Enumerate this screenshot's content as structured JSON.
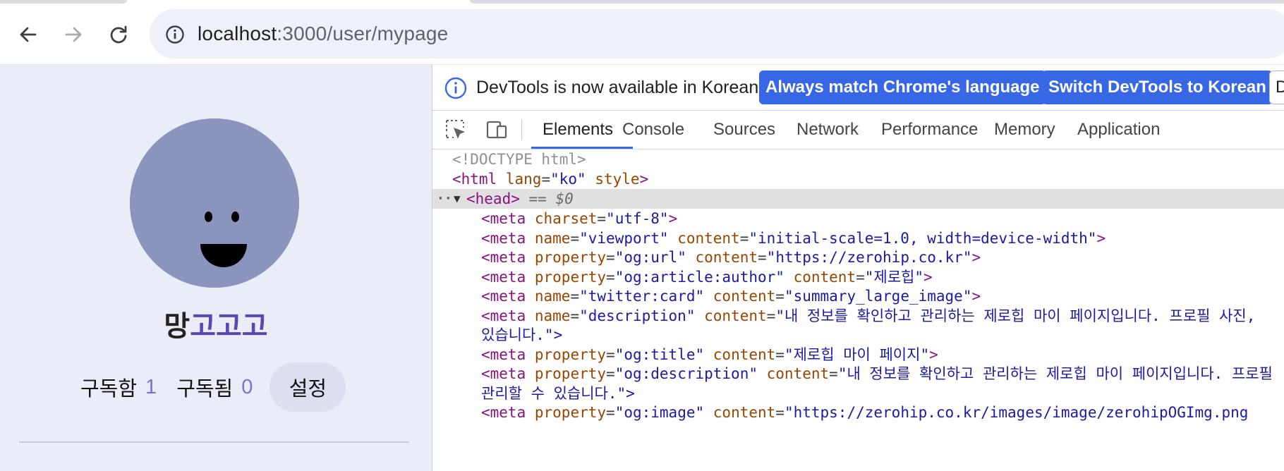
{
  "browser": {
    "url_host": "localhost",
    "url_path": ":3000/user/mypage",
    "nav": {
      "back_icon": "arrow-left",
      "forward_icon": "arrow-right",
      "reload_icon": "reload"
    }
  },
  "page": {
    "username_part1": "망",
    "username_part2": "고고고",
    "following_label": "구독함",
    "following_count": "1",
    "followers_label": "구독됨",
    "followers_count": "0",
    "settings_label": "설정"
  },
  "devtools": {
    "infobar": {
      "message": "DevTools is now available in Korean!",
      "button_match": "Always match Chrome's language",
      "button_switch": "Switch DevTools to Korean",
      "button_dismiss": "D"
    },
    "tabs": [
      "Elements",
      "Console",
      "Sources",
      "Network",
      "Performance",
      "Memory",
      "Application"
    ],
    "active_tab": "Elements",
    "code": {
      "doctype": "<!DOCTYPE html>",
      "html_open": "<html",
      "html_lang_attr": "lang",
      "html_lang_val": "\"ko\"",
      "html_style_attr": "style",
      "head_tag": "<head>",
      "head_ref": "== $0",
      "meta": [
        {
          "attr1": "charset",
          "val1": "\"utf-8\"",
          "attr2": "",
          "val2": ""
        },
        {
          "attr1": "name",
          "val1": "\"viewport\"",
          "attr2": "content",
          "val2": "\"initial-scale=1.0, width=device-width\""
        },
        {
          "attr1": "property",
          "val1": "\"og:url\"",
          "attr2": "content",
          "val2": "\"https://zerohip.co.kr\""
        },
        {
          "attr1": "property",
          "val1": "\"og:article:author\"",
          "attr2": "content",
          "val2": "\"제로힙\""
        },
        {
          "attr1": "name",
          "val1": "\"twitter:card\"",
          "attr2": "content",
          "val2": "\"summary_large_image\""
        },
        {
          "attr1": "name",
          "val1": "\"description\"",
          "attr2": "content",
          "val2": "\"내 정보를 확인하고 관리하는 제로힙 마이 페이지입니다. 프로필 사진,"
        },
        {
          "attr1": "property",
          "val1": "\"og:title\"",
          "attr2": "content",
          "val2": "\"제로힙 마이 페이지\""
        },
        {
          "attr1": "property",
          "val1": "\"og:description\"",
          "attr2": "content",
          "val2": "\"내 정보를 확인하고 관리하는 제로힙 마이 페이지입니다. 프로필"
        },
        {
          "attr1": "property",
          "val1": "\"og:image\"",
          "attr2": "content",
          "val2": "\"https://zerohip.co.kr/images/image/zerohipOGImg.png"
        }
      ],
      "description_wrap": "있습니다.\">",
      "og_description_wrap": "관리할 수 있습니다.\">"
    }
  },
  "colors": {
    "devtools_accent": "#3767e4",
    "page_background": "#eaedf7",
    "avatar": "#8a94bd",
    "count_accent": "#7d6fd6",
    "name_accent": "#5a48b0"
  }
}
